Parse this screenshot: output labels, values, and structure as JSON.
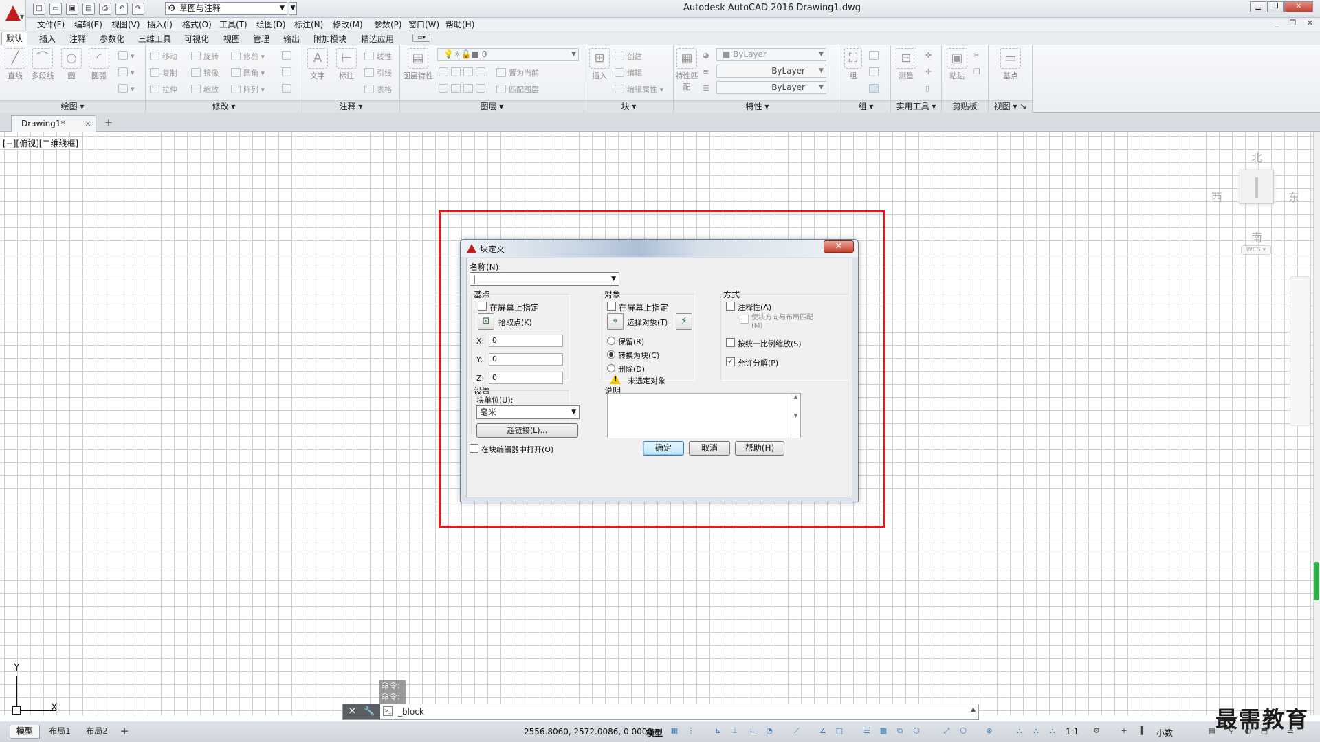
{
  "window": {
    "title": "Autodesk AutoCAD 2016    Drawing1.dwg",
    "workspace": "草图与注释"
  },
  "menu": [
    "文件(F)",
    "编辑(E)",
    "视图(V)",
    "插入(I)",
    "格式(O)",
    "工具(T)",
    "绘图(D)",
    "标注(N)",
    "修改(M)",
    "参数(P)",
    "窗口(W)",
    "帮助(H)"
  ],
  "ribbon_tabs": [
    "默认",
    "插入",
    "注释",
    "参数化",
    "三维工具",
    "可视化",
    "视图",
    "管理",
    "输出",
    "附加模块",
    "精选应用"
  ],
  "ribbon": {
    "draw": {
      "title": "绘图",
      "line": "直线",
      "polyline": "多段线",
      "circle": "圆",
      "arc": "圆弧"
    },
    "modify": {
      "title": "修改",
      "move": "移动",
      "rotate": "旋转",
      "trim": "修剪",
      "copy": "复制",
      "mirror": "镜像",
      "fillet": "圆角",
      "stretch": "拉伸",
      "scale": "缩放",
      "array": "阵列"
    },
    "annotation": {
      "title": "注释",
      "text": "文字",
      "dimension": "标注",
      "linear": "线性",
      "leader": "引线",
      "table": "表格"
    },
    "layers": {
      "title": "图层",
      "properties": "图层特性",
      "layer_value": "0",
      "set_current": "置为当前",
      "match": "匹配图层"
    },
    "block": {
      "title": "块",
      "insert": "插入",
      "create": "创建",
      "edit": "编辑",
      "edit_attr": "编辑属性"
    },
    "properties": {
      "title": "特性",
      "match": "特性匹配",
      "color": "ByLayer",
      "linetype": "ByLayer",
      "lineweight": "ByLayer"
    },
    "groups": {
      "title": "组",
      "group": "组"
    },
    "utilities": {
      "title": "实用工具",
      "measure": "测量"
    },
    "clipboard": {
      "title": "剪贴板",
      "paste": "粘贴"
    },
    "view": {
      "title": "视图",
      "base": "基点"
    }
  },
  "doc_tab": {
    "name": "Drawing1*",
    "close": "×",
    "add": "+"
  },
  "viewport": {
    "label": "[−][俯视][二维线框]"
  },
  "viewcube": {
    "north": "北",
    "south": "南",
    "east": "东",
    "west": "西",
    "wcs": "WCS"
  },
  "ucs": {
    "x": "X",
    "y": "Y"
  },
  "dialog": {
    "title": "块定义",
    "close": "✕",
    "name_label": "名称(N):",
    "name_value": "",
    "base_point": {
      "title": "基点",
      "specify_on_screen": "在屏幕上指定",
      "pick_point": "拾取点(K)",
      "x_label": "X:",
      "x": "0",
      "y_label": "Y:",
      "y": "0",
      "z_label": "Z:",
      "z": "0"
    },
    "objects": {
      "title": "对象",
      "specify_on_screen": "在屏幕上指定",
      "select_objects": "选择对象(T)",
      "retain": "保留(R)",
      "convert": "转换为块(C)",
      "delete": "删除(D)",
      "warning": "未选定对象"
    },
    "behavior": {
      "title": "方式",
      "annotative": "注释性(A)",
      "match_orientation": "使块方向与布局匹配(M)",
      "scale_uniformly": "按统一比例缩放(S)",
      "allow_explode": "允许分解(P)"
    },
    "settings": {
      "title": "设置",
      "block_unit_label": "块单位(U):",
      "block_unit": "毫米",
      "hyperlink": "超链接(L)..."
    },
    "description": {
      "title": "说明"
    },
    "open_in_editor": "在块编辑器中打开(O)",
    "ok": "确定",
    "cancel": "取消",
    "help": "帮助(H)"
  },
  "command": {
    "history1": "命令:",
    "history2": "命令:",
    "current": "_block"
  },
  "status": {
    "layout_tabs": [
      "模型",
      "布局1",
      "布局2"
    ],
    "add": "+",
    "coordinates": "2556.8060, 2572.0086, 0.0000",
    "model": "模型",
    "scale": "1:1",
    "units": "小数"
  },
  "watermark": "最需教育",
  "colors": {
    "accent": "#c21d1d",
    "highlight": "#e8171b",
    "scroll_thumb": "#2fb14a"
  }
}
